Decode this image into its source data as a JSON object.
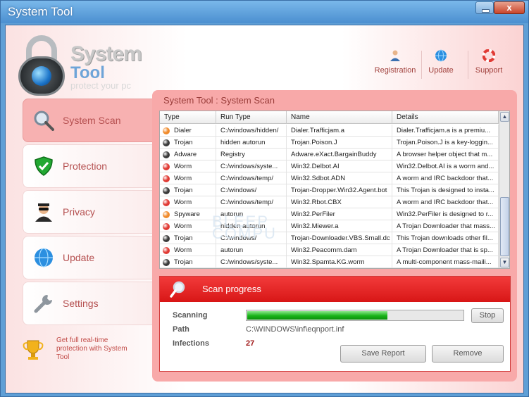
{
  "window": {
    "title": "System Tool",
    "close_label": "x"
  },
  "brand": {
    "line1": "System",
    "line2": "Tool",
    "tagline": "protect your pc"
  },
  "toolbar": [
    {
      "label": "Registration",
      "icon": "user-icon"
    },
    {
      "label": "Update",
      "icon": "globe-icon"
    },
    {
      "label": "Support",
      "icon": "lifebuoy-icon"
    }
  ],
  "sidebar": {
    "items": [
      {
        "label": "System Scan",
        "icon": "magnifier-icon",
        "active": true
      },
      {
        "label": "Protection",
        "icon": "shield-icon",
        "active": false
      },
      {
        "label": "Privacy",
        "icon": "spy-icon",
        "active": false
      },
      {
        "label": "Update",
        "icon": "globe-icon",
        "active": false
      },
      {
        "label": "Settings",
        "icon": "wrench-icon",
        "active": false
      }
    ],
    "upsell": "Get full real-time protection with System Tool"
  },
  "panel": {
    "title": "System Tool : System Scan"
  },
  "table": {
    "headers": [
      "Type",
      "Run Type",
      "Name",
      "Details"
    ],
    "rows": [
      {
        "status": "orange",
        "type": "Dialer",
        "run": "C:/windows/hidden/",
        "name": "Dialer.Trafficjam.a",
        "details": "Dialer.Trafficjam.a is a premiu..."
      },
      {
        "status": "dark",
        "type": "Trojan",
        "run": "hidden autorun",
        "name": "Trojan.Poison.J",
        "details": "Trojan.Poison.J is a key-loggin..."
      },
      {
        "status": "dark",
        "type": "Adware",
        "run": "Registry",
        "name": "Adware.eXact.BargainBuddy",
        "details": "A browser helper object that m..."
      },
      {
        "status": "red",
        "type": "Worm",
        "run": "C:/windows/syste...",
        "name": "Win32.Delbot.AI",
        "details": "Win32.Delbot.AI is a worm and..."
      },
      {
        "status": "red",
        "type": "Worm",
        "run": "C:/windows/temp/",
        "name": "Win32.Sdbot.ADN",
        "details": "A worm and IRC backdoor that..."
      },
      {
        "status": "dark",
        "type": "Trojan",
        "run": "C:/windows/",
        "name": "Trojan-Dropper.Win32.Agent.bot",
        "details": "This Trojan is designed to insta..."
      },
      {
        "status": "red",
        "type": "Worm",
        "run": "C:/windows/temp/",
        "name": "Win32.Rbot.CBX",
        "details": "A worm and IRC backdoor that..."
      },
      {
        "status": "orange",
        "type": "Spyware",
        "run": "autorun",
        "name": "Win32.PerFiler",
        "details": "Win32.PerFiler is designed to r..."
      },
      {
        "status": "red",
        "type": "Worm",
        "run": "hidden autorun",
        "name": "Win32.Miewer.a",
        "details": "A Trojan Downloader that mass..."
      },
      {
        "status": "dark",
        "type": "Trojan",
        "run": "C:/windows/",
        "name": "Trojan-Downloader.VBS.Small.dc",
        "details": "This Trojan downloads other fil..."
      },
      {
        "status": "red",
        "type": "Worm",
        "run": "autorun",
        "name": "Win32.Peacomm.dam",
        "details": "A Trojan Downloader that is sp..."
      },
      {
        "status": "dark",
        "type": "Trojan",
        "run": "C:/windows/syste...",
        "name": "Win32.Spamta.KG.worm",
        "details": "A multi-component mass-maili..."
      }
    ]
  },
  "scan": {
    "header": "Scan progress",
    "scanning_label": "Scanning",
    "path_label": "Path",
    "path_value": "C:\\WINDOWS\\inf\\eqnport.inf",
    "infections_label": "Infections",
    "infections_value": "27",
    "progress": 0.65,
    "stop_label": "Stop",
    "save_label": "Save Report",
    "remove_label": "Remove"
  },
  "colors": {
    "dot_red": "#e03a34",
    "dot_orange": "#f08a2a",
    "dot_dark": "#3a3a3a",
    "accent": "#d81616"
  }
}
